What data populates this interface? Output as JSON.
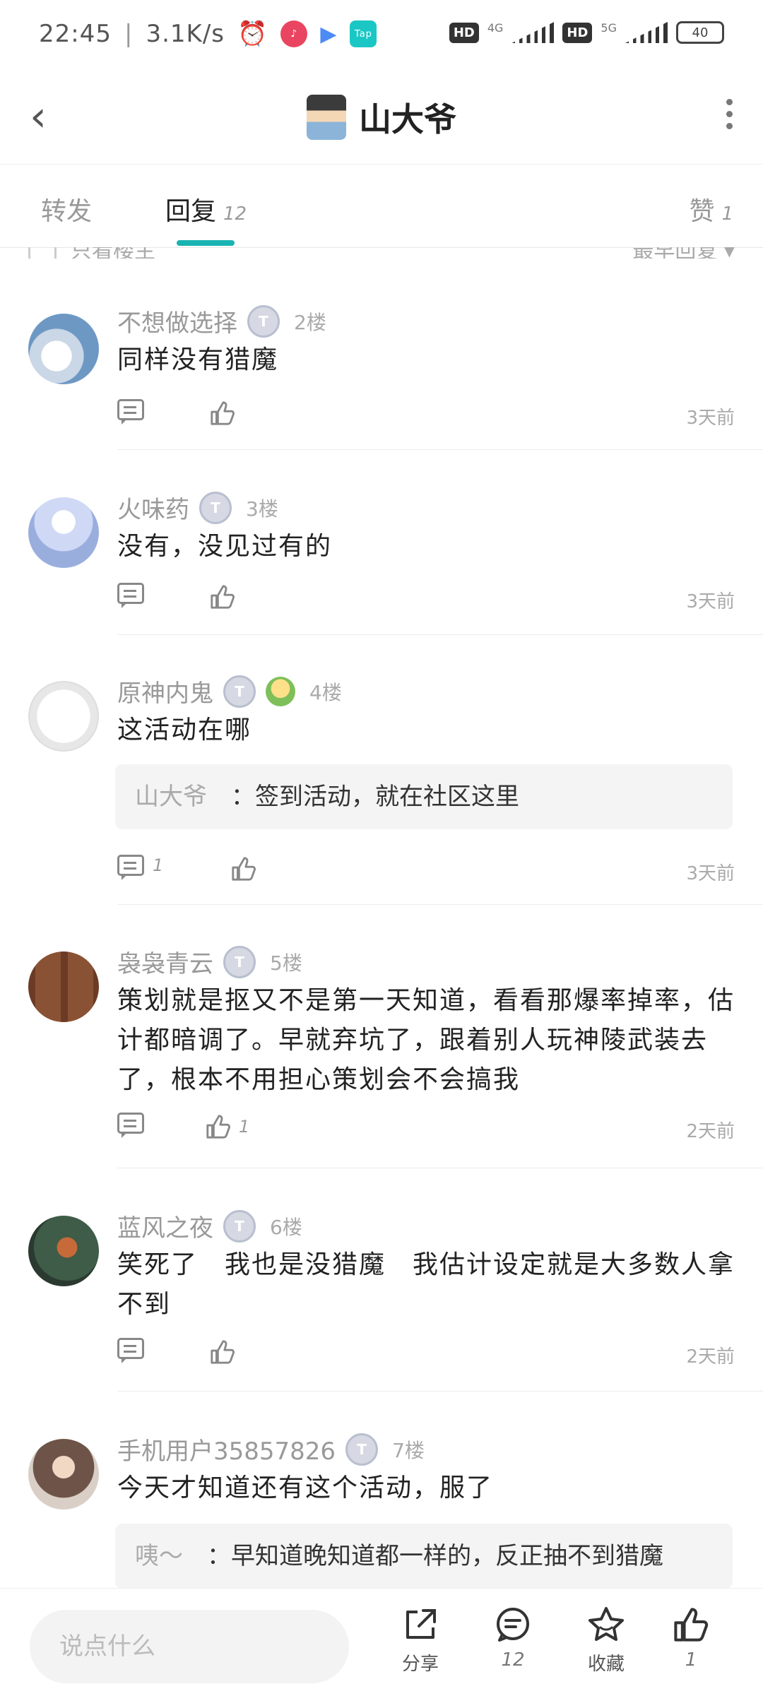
{
  "status_bar": {
    "time": "22:45",
    "speed": "3.1K/s",
    "hd1": "HD",
    "net1": "4G",
    "hd2": "HD",
    "net2": "5G",
    "battery": "40",
    "app_icon_label": "Tap"
  },
  "header": {
    "title": "山大爷"
  },
  "tabs": [
    {
      "label": "转发",
      "count": ""
    },
    {
      "label": "回复",
      "count": "12"
    },
    {
      "label": "赞",
      "count": "1"
    }
  ],
  "filter": {
    "only_author": "只看楼主",
    "sort": "最早回复"
  },
  "comments": [
    {
      "name": "不想做选择",
      "badge": "T",
      "floor": "2楼",
      "text": "同样没有猎魔",
      "time": "3天前",
      "reply_count": "",
      "like_count": ""
    },
    {
      "name": "火味药",
      "badge": "T",
      "floor": "3楼",
      "text": "没有，没见过有的",
      "time": "3天前",
      "reply_count": "",
      "like_count": ""
    },
    {
      "name": "原神内鬼",
      "badge": "T",
      "floor": "4楼",
      "text": "这活动在哪",
      "quote_name": "山大爷",
      "quote_text": "：签到活动，就在社区这里",
      "time": "3天前",
      "reply_count": "1",
      "like_count": ""
    },
    {
      "name": "袅袅青云",
      "badge": "T",
      "floor": "5楼",
      "text": "策划就是抠又不是第一天知道，看看那爆率掉率，估计都暗调了。早就弃坑了，跟着别人玩神陵武装去了，根本不用担心策划会不会搞我",
      "time": "2天前",
      "reply_count": "",
      "like_count": "1"
    },
    {
      "name": "蓝风之夜",
      "badge": "T",
      "floor": "6楼",
      "text": "笑死了　我也是没猎魔　我估计设定就是大多数人拿不到",
      "time": "2天前",
      "reply_count": "",
      "like_count": ""
    },
    {
      "name": "手机用户35857826",
      "badge": "T",
      "floor": "7楼",
      "text": "今天才知道还有这个活动，服了",
      "quote_name": "咦～",
      "quote_text": "：早知道晚知道都一样的，反正抽不到猎魔"
    }
  ],
  "bottom_bar": {
    "input_placeholder": "说点什么",
    "share_label": "分享",
    "reply_count": "12",
    "favorite_label": "收藏",
    "like_count": "1"
  },
  "colors": {
    "accent": "#19b4b2",
    "text_primary": "#222222",
    "text_secondary": "#999999"
  }
}
